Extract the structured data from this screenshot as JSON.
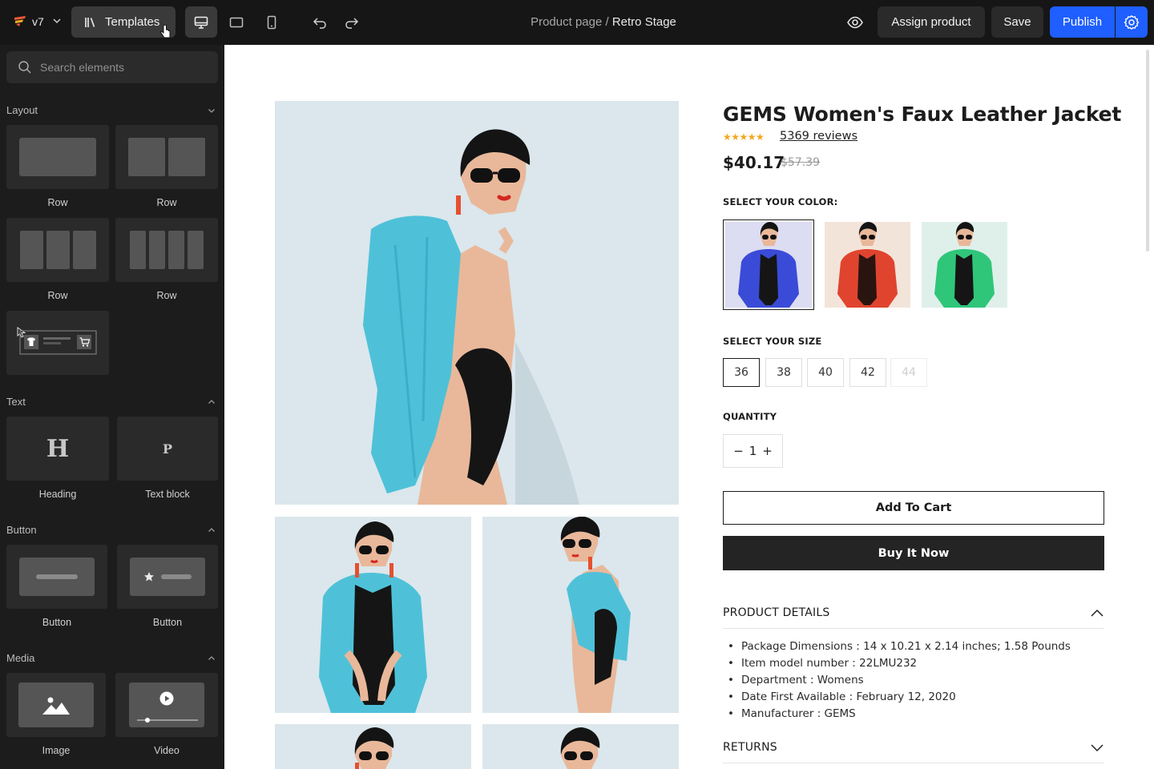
{
  "app": {
    "version": "v7",
    "templates_label": "Templates",
    "breadcrumb_path": "Product page",
    "breadcrumb_sep": "/",
    "breadcrumb_current": "Retro Stage",
    "assign_label": "Assign product",
    "save_label": "Save",
    "publish_label": "Publish",
    "accent": "#1f5eff"
  },
  "sidebar": {
    "search_placeholder": "Search elements",
    "sections": {
      "layout": "Layout",
      "text": "Text",
      "button": "Button",
      "media": "Media"
    },
    "layout_tiles": [
      "Row",
      "Row",
      "Row",
      "Row"
    ],
    "text_tiles": [
      "Heading",
      "Text block"
    ],
    "text_glyphs": [
      "H",
      "P"
    ],
    "button_tiles": [
      "Button",
      "Button"
    ],
    "media_tiles": [
      "Image",
      "Video"
    ]
  },
  "product": {
    "title": "GEMS Women's Faux Leather Jacket",
    "rating_stars": "★★★★★",
    "rating": 5,
    "reviews": "5369 reviews",
    "price": "$40.17",
    "compare_price": "$57.39",
    "color_label": "SELECT YOUR COLOR:",
    "colors": [
      {
        "name": "blue",
        "hex": "#3a4bd8"
      },
      {
        "name": "red",
        "hex": "#e0442f"
      },
      {
        "name": "green",
        "hex": "#2fc67a"
      }
    ],
    "size_label": "SELECT YOUR SIZE",
    "sizes": [
      "36",
      "38",
      "40",
      "42",
      "44"
    ],
    "selected_size": "36",
    "unavailable_size": "44",
    "quantity_label": "QUANTITY",
    "qty_minus": "−",
    "qty_value": "1",
    "qty_plus": "+",
    "add_to_cart": "Add To Cart",
    "buy_now": "Buy It Now",
    "details_title": "PRODUCT DETAILS",
    "details": [
      "Package Dimensions  :  14 x 10.21 x 2.14 inches; 1.58 Pounds",
      "Item model number  :  22LMU232",
      "Department  :  Womens",
      "Date First Available  :  February 12, 2020",
      "Manufacturer  :  GEMS"
    ],
    "returns_title": "RETURNS",
    "jacket_color": "#4ec1d8"
  }
}
